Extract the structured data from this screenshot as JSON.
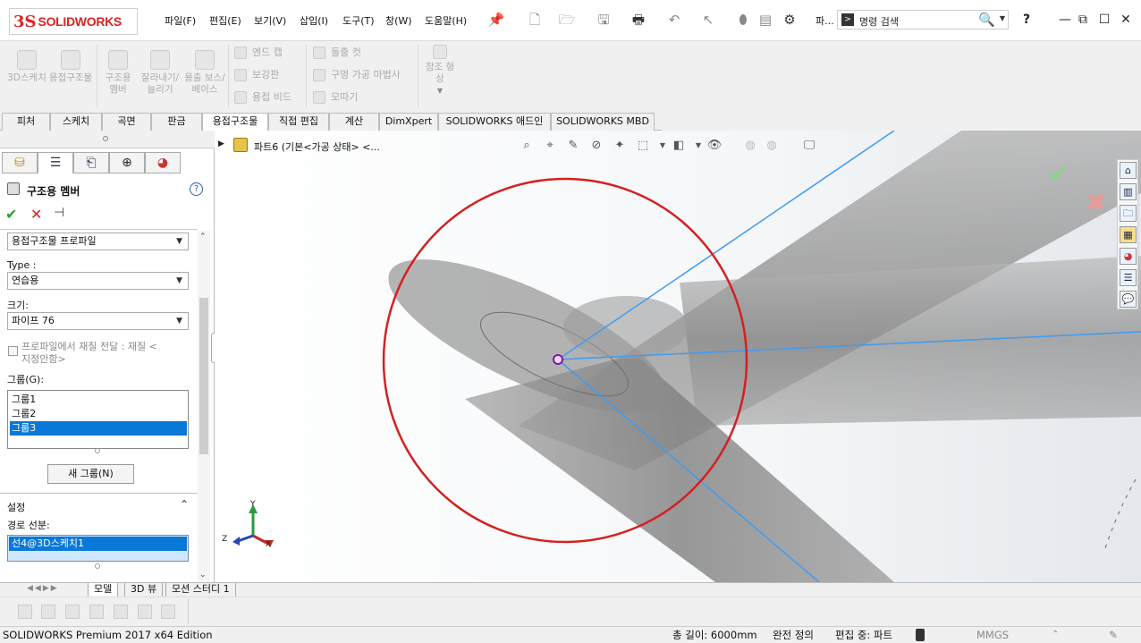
{
  "app": {
    "logo_prefix": "3S",
    "logo_text": "SOLIDWORKS"
  },
  "menu": [
    "파일(F)",
    "편집(E)",
    "보기(V)",
    "삽입(I)",
    "도구(T)",
    "창(W)",
    "도움말(H)"
  ],
  "search": {
    "placeholder": "명령 검색"
  },
  "toolbar": {
    "partial_label": "파..."
  },
  "ribbon": {
    "big_buttons": [
      "3D스케치",
      "용접구조물",
      "구조용 멤버",
      "잘라내기/늘리기",
      "용출 보스/베이스"
    ],
    "small_col1": [
      "엔드 캡",
      "보강판",
      "용접 비드"
    ],
    "small_col2": [
      "돌출 컷",
      "구멍 가공 마법사",
      "모따기"
    ],
    "ref_geom": "참조 형상"
  },
  "command_tabs": [
    "피처",
    "스케치",
    "곡면",
    "판금",
    "용접구조물",
    "직접 편집",
    "계산",
    "DimXpert",
    "SOLIDWORKS 애드인",
    "SOLIDWORKS MBD"
  ],
  "active_command_tab": "용접구조물",
  "feature_tree": {
    "part": "파트6  (기본<가공 상태> <..."
  },
  "property_manager": {
    "title": "구조용 멤버",
    "standard": "용접구조물 프로파일",
    "type_label": "Type :",
    "type_value": "연습용",
    "size_label": "크기:",
    "size_value": "파이프 76",
    "transfer_material_line1": "프로파일에서 재질 전달 : 재질 <",
    "transfer_material_line2": "지정안함>",
    "groups_label": "그룹(G):",
    "groups": [
      "그룹1",
      "그룹2",
      "그룹3"
    ],
    "selected_group": "그룹3",
    "new_group_button": "새 그룹(N)",
    "settings_label": "설정",
    "path_segments_label": "경로 선분:",
    "path_segments": [
      "선4@3D스케치1"
    ]
  },
  "bottom_tabs": [
    "모델",
    "3D 뷰",
    "모션 스터디 1"
  ],
  "status": {
    "edition": "SOLIDWORKS Premium 2017 x64 Edition",
    "total_length": "총 길이: 6000mm",
    "fully_defined": "완전 정의",
    "editing": "편집 중: 파트",
    "units": "MMGS"
  },
  "triad": {
    "x": "X",
    "y": "Y",
    "z": "Z"
  },
  "colors": {
    "brand_red": "#d22222",
    "selection_blue": "#0a78d7",
    "sketch_line": "#3f9bf0",
    "highlight_circle": "#d42020",
    "ok_green": "#2e9b2e",
    "cancel_red": "#d02222"
  }
}
